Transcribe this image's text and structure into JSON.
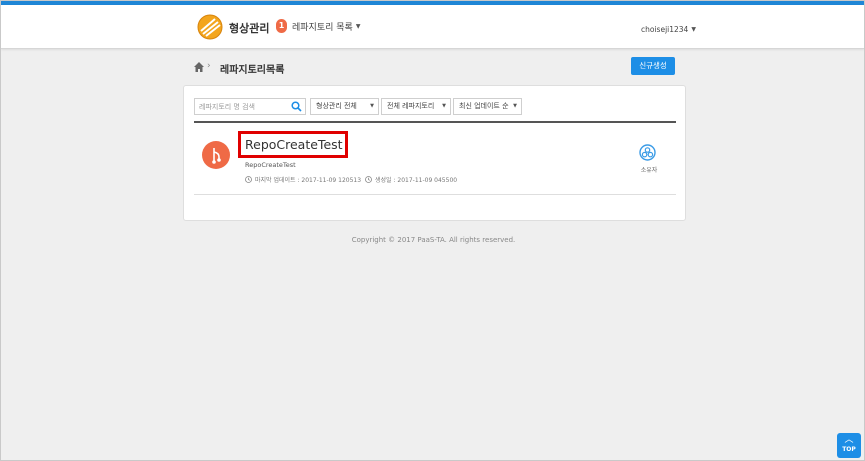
{
  "header": {
    "app_title": "형상관리",
    "repo_menu": {
      "badge": "1",
      "label": "레파지토리 목록"
    },
    "user": "choiseji1234"
  },
  "breadcrumb": {
    "title": "레파지토리목록"
  },
  "toolbar": {
    "new_button": "신규생성"
  },
  "filters": {
    "search_placeholder": "레파지토리 명 검색",
    "dropdowns": [
      {
        "selected": "형상관리 전체"
      },
      {
        "selected": "전체 레파지토리"
      },
      {
        "selected": "최신 업데이트 순"
      }
    ]
  },
  "repos": [
    {
      "name": "RepoCreateTest",
      "description": "RepoCreateTest",
      "last_updated": "마지막 업데이트 : 2017-11-09 120513",
      "created": "생성일 : 2017-11-09 045500",
      "role": "소유자"
    }
  ],
  "footer": {
    "copyright": "Copyright © 2017 PaaS-TA. All rights reserved."
  },
  "top_button": {
    "label": "TOP"
  },
  "colors": {
    "accent": "#1d8ee6",
    "badge": "#ef6a46",
    "highlight": "#e00000",
    "repo_icon": "#ef6a46"
  }
}
